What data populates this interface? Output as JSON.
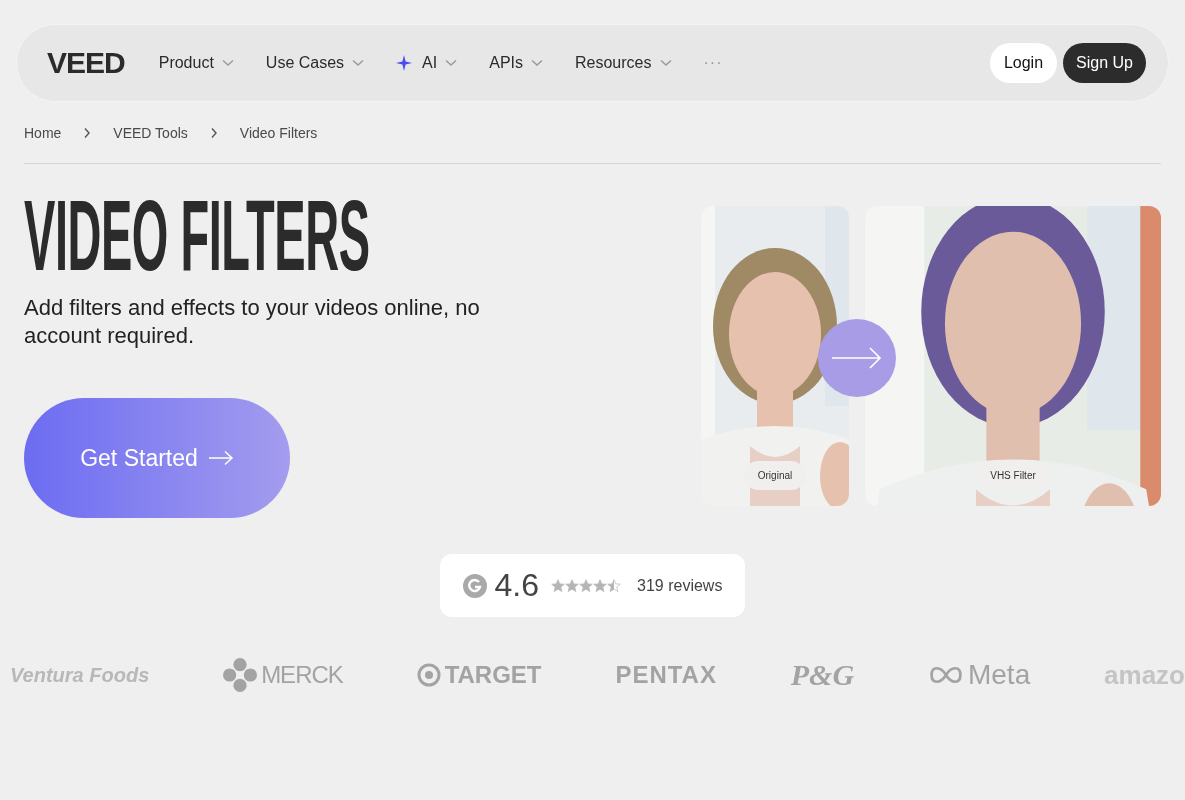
{
  "nav": {
    "logo": "VEED",
    "items": [
      {
        "label": "Product",
        "kind": "menu"
      },
      {
        "label": "Use Cases",
        "kind": "menu"
      },
      {
        "label": "AI",
        "kind": "ai"
      },
      {
        "label": "APIs",
        "kind": "menu"
      },
      {
        "label": "Resources",
        "kind": "menu"
      }
    ],
    "more": "···",
    "login": "Login",
    "signup": "Sign Up"
  },
  "breadcrumb": [
    "Home",
    "VEED Tools",
    "Video Filters"
  ],
  "hero": {
    "title": "VIDEO FILTERS",
    "subtitle": "Add filters and effects to your videos online, no account required.",
    "cta": "Get Started"
  },
  "previews": [
    {
      "label": "Original",
      "kind": "original"
    },
    {
      "label": "VHS Filter",
      "kind": "vhs"
    }
  ],
  "rating": {
    "score": "4.6",
    "stars": 4.5,
    "reviews": "319 reviews"
  },
  "logos": [
    {
      "text": "Ventura Foods",
      "kind": "ventura"
    },
    {
      "text": "MERCK",
      "kind": "merck"
    },
    {
      "text": "TARGET",
      "kind": "target"
    },
    {
      "text": "PENTAX",
      "kind": "pentax"
    },
    {
      "text": "P&G",
      "kind": "pg"
    },
    {
      "text": "Meta",
      "kind": "meta"
    },
    {
      "text": "amazo",
      "kind": "amazon"
    }
  ]
}
